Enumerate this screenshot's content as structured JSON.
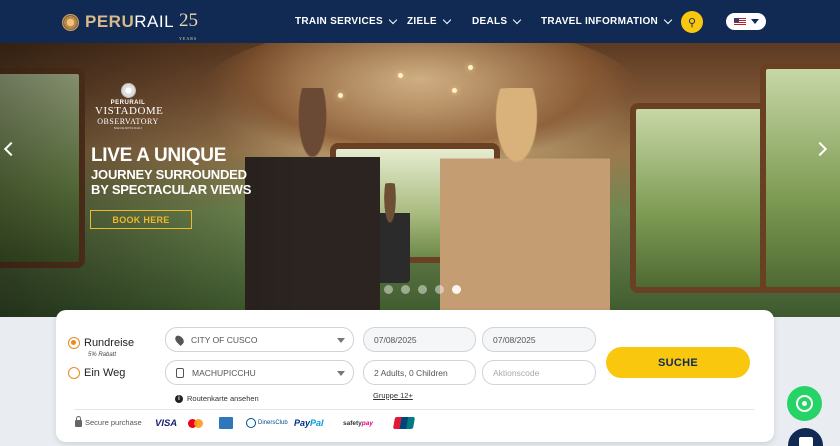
{
  "header": {
    "logo_word_a": "PERU",
    "logo_word_b": "RAIL",
    "anniversary": "25",
    "anniversary_sub": "YEARS",
    "nav": [
      {
        "label": "TRAIN SERVICES"
      },
      {
        "label": "ZIELE"
      },
      {
        "label": "DEALS"
      },
      {
        "label": "TRAVEL INFORMATION"
      }
    ],
    "language": "US flag"
  },
  "hero": {
    "brand_small": "PERURAIL",
    "brand_name": "VISTADOME",
    "brand_sub": "OBSERVATORY",
    "brand_tag": "MACHUPICCHU",
    "headline_1": "LIVE A UNIQUE",
    "headline_2": "JOURNEY SURROUNDED",
    "headline_3": "BY SPECTACULAR VIEWS",
    "cta": "BOOK HERE",
    "slides_total": 5,
    "active_slide": 5
  },
  "booking": {
    "trip_types": [
      {
        "label": "Rundreise",
        "selected": true,
        "note": "5% Rabatt"
      },
      {
        "label": "Ein Weg",
        "selected": false
      }
    ],
    "origin": "CITY OF CUSCO",
    "destination": "MACHUPICCHU",
    "date_outbound": "07/08/2025",
    "date_return": "07/08/2025",
    "passengers": "2 Adults, 0 Children",
    "promo_placeholder": "Aktionscode",
    "search_label": "SUCHE",
    "route_map_label": "Routenkarte ansehen",
    "group_label": "Gruppe 12+",
    "secure_label": "Secure purchase",
    "payment_methods": {
      "visa": "VISA",
      "diners": "DinersClub",
      "paypal_a": "Pay",
      "paypal_b": "Pal",
      "safety_a": "safety",
      "safety_b": "pay"
    }
  },
  "colors": {
    "navy": "#102a54",
    "accent_yellow": "#f9c80e",
    "radio_orange": "#e98a1e",
    "whatsapp_green": "#25d366"
  }
}
